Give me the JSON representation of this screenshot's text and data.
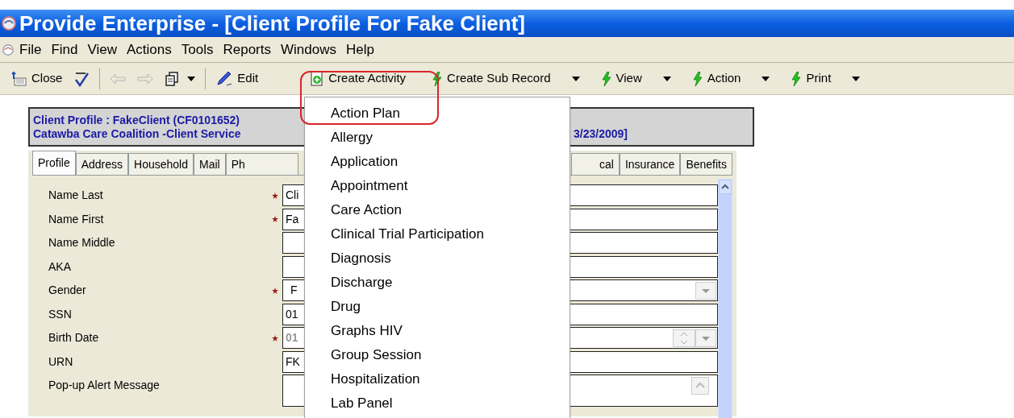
{
  "window": {
    "title": "Provide Enterprise - [Client Profile For Fake Client]"
  },
  "menu_bar": [
    "File",
    "Find",
    "View",
    "Actions",
    "Tools",
    "Reports",
    "Windows",
    "Help"
  ],
  "toolbar": [
    {
      "kind": "button",
      "label": "Close",
      "disabled": false,
      "has_menu": false
    },
    {
      "kind": "icon",
      "disabled": false,
      "has_menu": false
    },
    {
      "kind": "separator"
    },
    {
      "kind": "icon",
      "disabled": true,
      "has_menu": false
    },
    {
      "kind": "icon",
      "disabled": true,
      "has_menu": false
    },
    {
      "kind": "icon",
      "disabled": false,
      "has_menu": true
    },
    {
      "kind": "separator"
    },
    {
      "kind": "button",
      "label": "Edit",
      "disabled": false,
      "has_menu": false
    },
    {
      "kind": "button",
      "label": "Create Activity",
      "disabled": false,
      "has_menu": false
    },
    {
      "kind": "button",
      "label": "Create Sub Record",
      "disabled": false,
      "has_menu": true
    },
    {
      "kind": "button",
      "label": "View",
      "disabled": false,
      "has_menu": true
    },
    {
      "kind": "button",
      "label": "Action",
      "disabled": false,
      "has_menu": true
    },
    {
      "kind": "button",
      "label": "Print",
      "disabled": false,
      "has_menu": true
    }
  ],
  "header": {
    "line_1": "Client Profile : FakeClient (CF0101652)",
    "line_2": "Catawba Care Coalition -Client Service",
    "line_2_end": "3/23/2009]"
  },
  "tabs_left": [
    {
      "label": "Profile",
      "selected": true
    },
    {
      "label": "Address",
      "selected": false
    },
    {
      "label": "Household",
      "selected": false
    },
    {
      "label": "Mail",
      "selected": false
    },
    {
      "label": "Ph",
      "selected": false
    }
  ],
  "tabs_right": [
    {
      "label": "cal",
      "selected": false
    },
    {
      "label": "Insurance",
      "selected": false
    },
    {
      "label": "Benefits",
      "selected": false
    }
  ],
  "fields": [
    {
      "kind": "text",
      "label": "Name Last",
      "required": true,
      "value": "Cli"
    },
    {
      "kind": "text",
      "label": "Name First",
      "required": true,
      "value": "Fa"
    },
    {
      "kind": "text",
      "label": "Name Middle",
      "required": false
    },
    {
      "kind": "text",
      "label": "AKA",
      "required": false
    },
    {
      "kind": "select",
      "label": "Gender",
      "required": true,
      "value": "F"
    },
    {
      "kind": "text",
      "label": "SSN",
      "required": false,
      "value": "01"
    },
    {
      "kind": "date",
      "label": "Birth Date",
      "required": true,
      "value": "01"
    },
    {
      "kind": "text",
      "label": "URN",
      "required": false,
      "value": "FK"
    },
    {
      "kind": "memo",
      "label": "Pop-up Alert Message",
      "required": false
    }
  ],
  "activity_menu": {
    "items": [
      "Action Plan",
      "Allergy",
      "Application",
      "Appointment",
      "Care Action",
      "Clinical Trial Participation",
      "Diagnosis",
      "Discharge",
      "Drug",
      "Graphs HIV",
      "Group Session",
      "Hospitalization",
      "Lab Panel"
    ]
  }
}
